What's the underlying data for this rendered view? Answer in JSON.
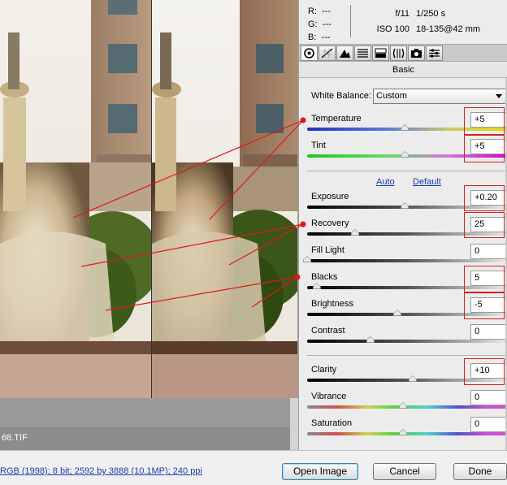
{
  "left": {
    "filename": "68.TIF"
  },
  "info": {
    "r_label": "R:",
    "r_value": "---",
    "g_label": "G:",
    "g_value": "---",
    "b_label": "B:",
    "b_value": "---",
    "aperture": "f/11",
    "shutter": "1/250 s",
    "iso": "ISO 100",
    "lens": "18-135@42 mm"
  },
  "tabs": [
    {
      "icon": "aperture-icon"
    },
    {
      "icon": "tone-curve-icon"
    },
    {
      "icon": "detail-icon"
    },
    {
      "icon": "hsl-icon"
    },
    {
      "icon": "split-toning-icon"
    },
    {
      "icon": "lens-corrections-icon"
    },
    {
      "icon": "camera-calibration-icon"
    },
    {
      "icon": "presets-icon"
    }
  ],
  "panel_title": "Basic",
  "white_balance": {
    "label": "White Balance:",
    "value": "Custom"
  },
  "sliders": {
    "temperature": {
      "label": "Temperature",
      "value": "+5",
      "position": 0.51
    },
    "tint": {
      "label": "Tint",
      "value": "+5",
      "position": 0.51
    },
    "exposure": {
      "label": "Exposure",
      "value": "+0.20",
      "position": 0.51
    },
    "recovery": {
      "label": "Recovery",
      "value": "25",
      "position": 0.25
    },
    "fill_light": {
      "label": "Fill Light",
      "value": "0",
      "position": 0.0
    },
    "blacks": {
      "label": "Blacks",
      "value": "5",
      "position": 0.05
    },
    "brightness": {
      "label": "Brightness",
      "value": "-5",
      "position": 0.47
    },
    "contrast": {
      "label": "Contrast",
      "value": "0",
      "position": 0.33
    },
    "clarity": {
      "label": "Clarity",
      "value": "+10",
      "position": 0.55
    },
    "vibrance": {
      "label": "Vibrance",
      "value": "0",
      "position": 0.5
    },
    "saturation": {
      "label": "Saturation",
      "value": "0",
      "position": 0.5
    }
  },
  "links": {
    "auto": "Auto",
    "default": "Default"
  },
  "footer": {
    "workflow": "RGB (1998); 8 bit; 2592 by 3888 (10.1MP); 240 ppi",
    "open_image": "Open Image",
    "cancel": "Cancel",
    "done": "Done"
  },
  "colors": {
    "highlight": "#d42020",
    "link": "#1a3ab0"
  }
}
